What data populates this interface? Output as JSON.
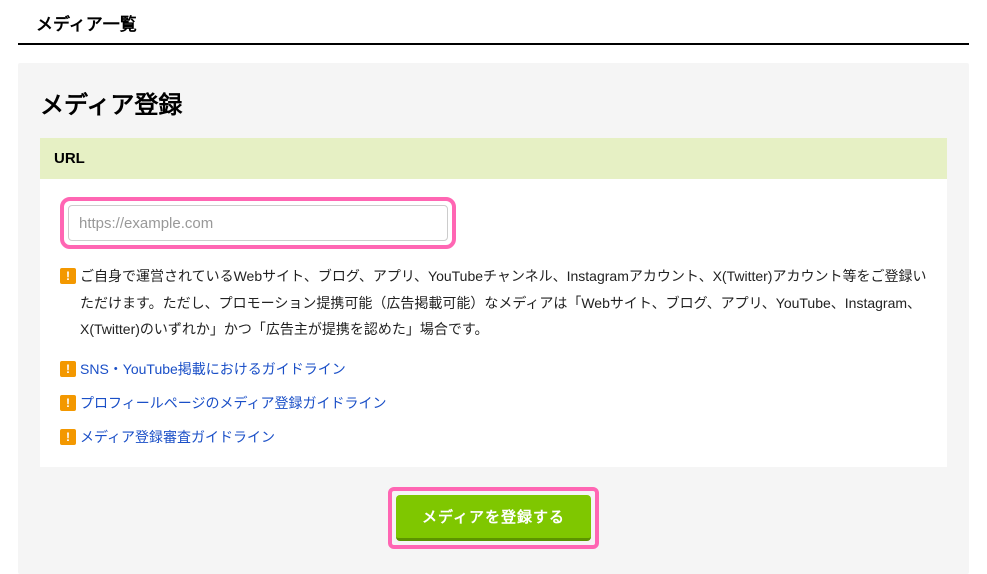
{
  "page": {
    "title": "メディア一覧",
    "panel_title": "メディア登録"
  },
  "section": {
    "header": "URL",
    "url_placeholder": "https://example.com"
  },
  "info_icon_glyph": "!",
  "description": "ご自身で運営されているWebサイト、ブログ、アプリ、YouTubeチャンネル、Instagramアカウント、X(Twitter)アカウント等をご登録いただけます。ただし、プロモーション提携可能（広告掲載可能）なメディアは「Webサイト、ブログ、アプリ、YouTube、Instagram、X(Twitter)のいずれか」かつ「広告主が提携を認めた」場合です。",
  "links": {
    "sns": "SNS・YouTube掲載におけるガイドライン",
    "profile": "プロフィールページのメディア登録ガイドライン",
    "review": "メディア登録審査ガイドライン"
  },
  "submit": {
    "label": "メディアを登録する"
  }
}
